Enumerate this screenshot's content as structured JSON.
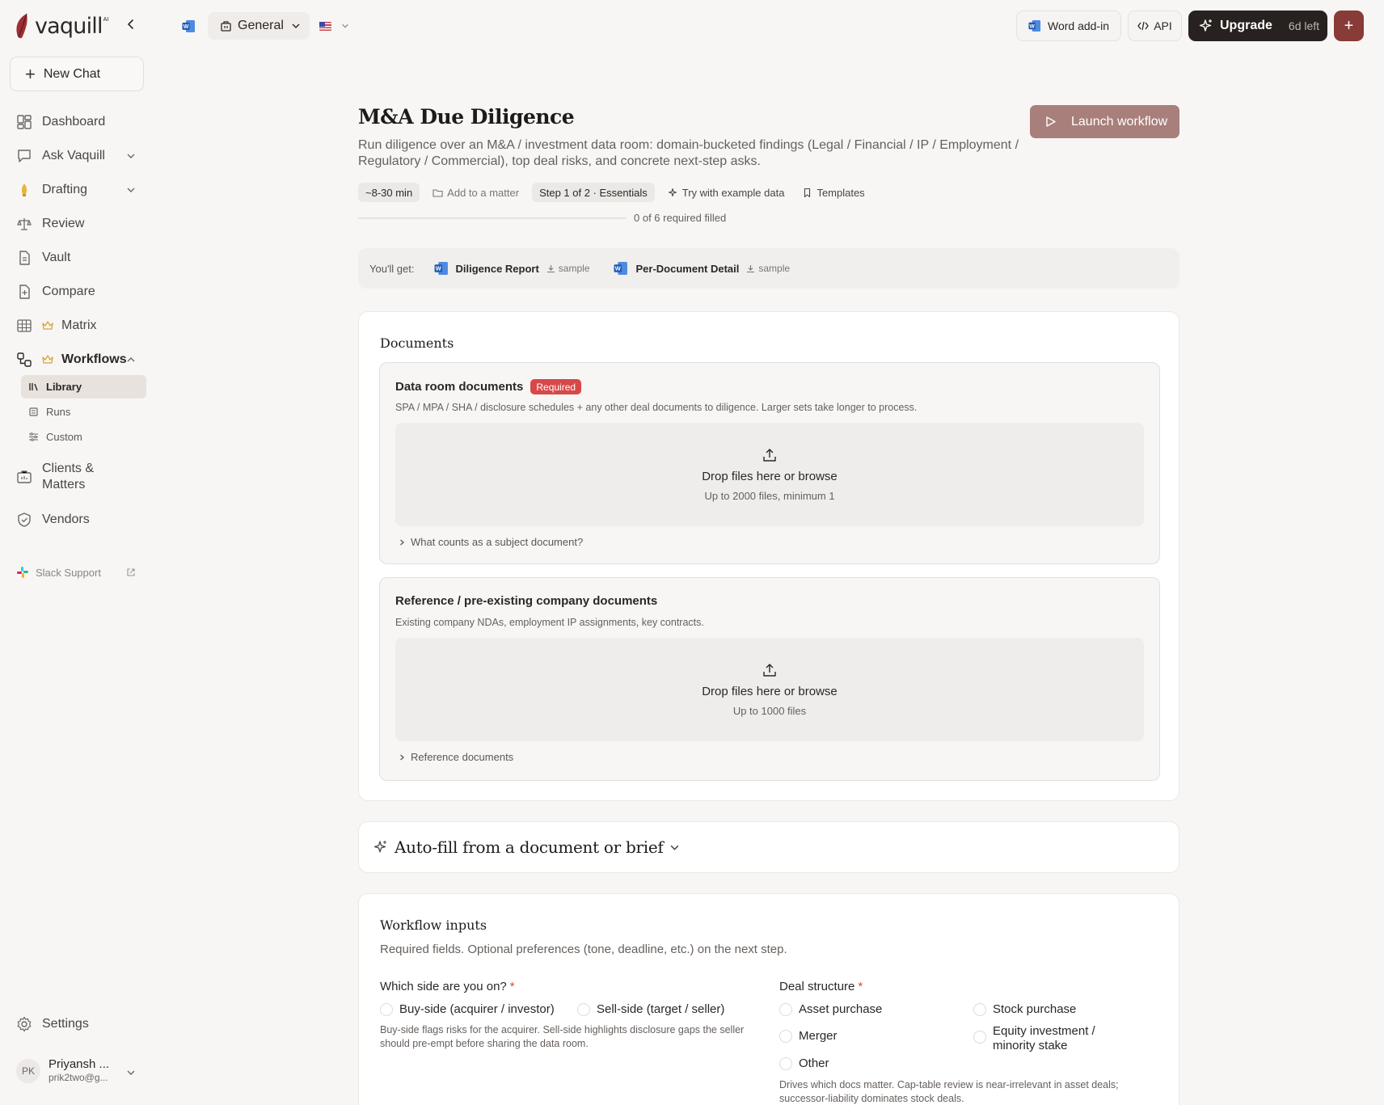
{
  "brand": {
    "logo_text": "vaquill",
    "logo_ai": "AI"
  },
  "topbar": {
    "workspace": "General",
    "word_addin": "Word add-in",
    "api": "API",
    "upgrade": "Upgrade",
    "days_left": "6d left",
    "plus": "+"
  },
  "sidebar": {
    "new_chat": "New Chat",
    "items": {
      "dashboard": "Dashboard",
      "ask": "Ask Vaquill",
      "drafting": "Drafting",
      "review": "Review",
      "vault": "Vault",
      "compare": "Compare",
      "matrix": "Matrix",
      "workflows": "Workflows",
      "clients_1": "Clients &",
      "clients_2": "Matters",
      "vendors": "Vendors"
    },
    "workflow_sub": {
      "library": "Library",
      "runs": "Runs",
      "custom": "Custom"
    },
    "slack": "Slack Support",
    "settings": "Settings",
    "user": {
      "initials": "PK",
      "name": "Priyansh ...",
      "email": "prik2two@g..."
    }
  },
  "page": {
    "title": "M&A Due Diligence",
    "launch": "Launch workflow",
    "description": "Run diligence over an M&A / investment data room: domain-bucketed findings (Legal / Financial / IP / Employment / Regulatory / Commercial), top deal risks, and concrete next-step asks.",
    "chips": {
      "time": "~8-30 min",
      "add_matter": "Add to a matter",
      "step": "Step 1 of 2 · Essentials",
      "example": "Try with example data",
      "templates": "Templates"
    },
    "progress": "0 of 6 required filled",
    "you_get": {
      "label": "You'll get:",
      "items": [
        {
          "name": "Diligence Report",
          "sample": "sample"
        },
        {
          "name": "Per-Document Detail",
          "sample": "sample"
        }
      ]
    }
  },
  "documents": {
    "title": "Documents",
    "data_room": {
      "title": "Data room documents",
      "badge": "Required",
      "desc": "SPA / MPA / SHA / disclosure schedules + any other deal documents to diligence. Larger sets take longer to process.",
      "drop_main": "Drop files here or browse",
      "drop_sub": "Up to 2000 files, minimum 1",
      "expander": "What counts as a subject document?"
    },
    "reference": {
      "title": "Reference / pre-existing company documents",
      "desc": "Existing company NDAs, employment IP assignments, key contracts.",
      "drop_main": "Drop files here or browse",
      "drop_sub": "Up to 1000 files",
      "expander": "Reference documents"
    }
  },
  "autofill": {
    "title": "Auto-fill from a document or brief"
  },
  "workflow_inputs": {
    "title": "Workflow inputs",
    "desc": "Required fields. Optional preferences (tone, deadline, etc.) on the next step.",
    "side": {
      "label": "Which side are you on?",
      "star": "*",
      "options": [
        "Buy-side (acquirer / investor)",
        "Sell-side (target / seller)"
      ],
      "help": "Buy-side flags risks for the acquirer. Sell-side highlights disclosure gaps the seller should pre-empt before sharing the data room."
    },
    "structure": {
      "label": "Deal structure",
      "star": "*",
      "options": [
        "Asset purchase",
        "Stock purchase",
        "Merger",
        "Equity investment / minority stake",
        "Other"
      ],
      "help": "Drives which docs matter. Cap-table review is near-irrelevant in asset deals; successor-liability dominates stock deals."
    }
  },
  "colors": {
    "accent": "#883b37",
    "launch": "#a87f7b",
    "required": "#d74848",
    "upgrade_bg": "#27211f"
  }
}
